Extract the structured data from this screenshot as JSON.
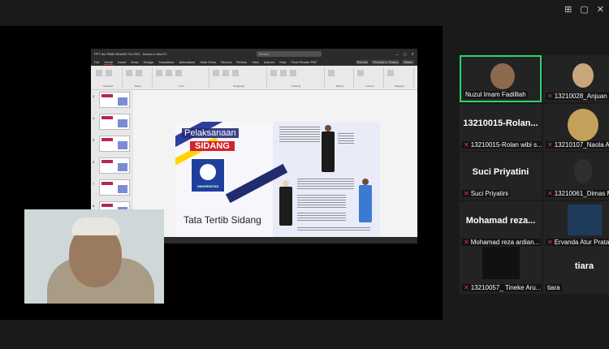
{
  "window": {
    "top_icons": [
      "⊞",
      "▢",
      "✕"
    ]
  },
  "powerpoint": {
    "file_title": "PPT Ibu PMB SIDANG TA 2023 - Saved to this PC",
    "search_placeholder": "Search",
    "menu": [
      "File",
      "Home",
      "Insert",
      "Draw",
      "Design",
      "Transitions",
      "Animations",
      "Slide Show",
      "Record",
      "Review",
      "View",
      "Add-ins",
      "Help",
      "Foxit Reader PDF"
    ],
    "active_menu": "Home",
    "right_buttons": [
      "Record",
      "Present in Teams",
      "Share"
    ],
    "ribbon_groups": [
      "Clipboard",
      "Slides",
      "Font",
      "Paragraph",
      "Drawing",
      "Editing",
      "Add-ins",
      "Designer"
    ],
    "thumb_numbers": [
      "3",
      "4",
      "5",
      "6",
      "7",
      "8"
    ],
    "status_text": "Slide 1 of 17   Indonesian   Accessibility: Investigate",
    "slide": {
      "title_line1": "Pelaksanaan",
      "title_line2": "SIDANG",
      "logo_text": "UNIVERSITAS",
      "subtitle": "Tata Tertib Sidang"
    }
  },
  "participants": [
    {
      "big": "",
      "label": "Nuzul Imam Fadilllah",
      "muted": false,
      "active": true
    },
    {
      "big": "",
      "label": "13210028_Anjuan",
      "muted": true,
      "active": false
    },
    {
      "big": "13210015-Rolan...",
      "label": "13210015-Rolan wibi s...",
      "muted": true,
      "active": false
    },
    {
      "big": "",
      "label": "13210107_Naola A",
      "muted": true,
      "active": false
    },
    {
      "big": "Suci Priyatini",
      "label": "Suci Priyatini",
      "muted": true,
      "active": false
    },
    {
      "big": "",
      "label": "13210061_Dimas M",
      "muted": true,
      "active": false
    },
    {
      "big": "Mohamad reza...",
      "label": "Mohamad reza ardian...",
      "muted": true,
      "active": false
    },
    {
      "big": "",
      "label": "Ervanda Atur Prata",
      "muted": true,
      "active": false
    },
    {
      "big": "",
      "label": "13210057_ Tineke Aru...",
      "muted": true,
      "active": false
    },
    {
      "big": "tiara",
      "label": "tiara",
      "muted": false,
      "active": false
    }
  ],
  "colors": {
    "active_speaker": "#2bd66b",
    "muted_mic": "#e23a3a",
    "slide_red": "#d4232b",
    "slide_blue": "#1e3f9c"
  }
}
